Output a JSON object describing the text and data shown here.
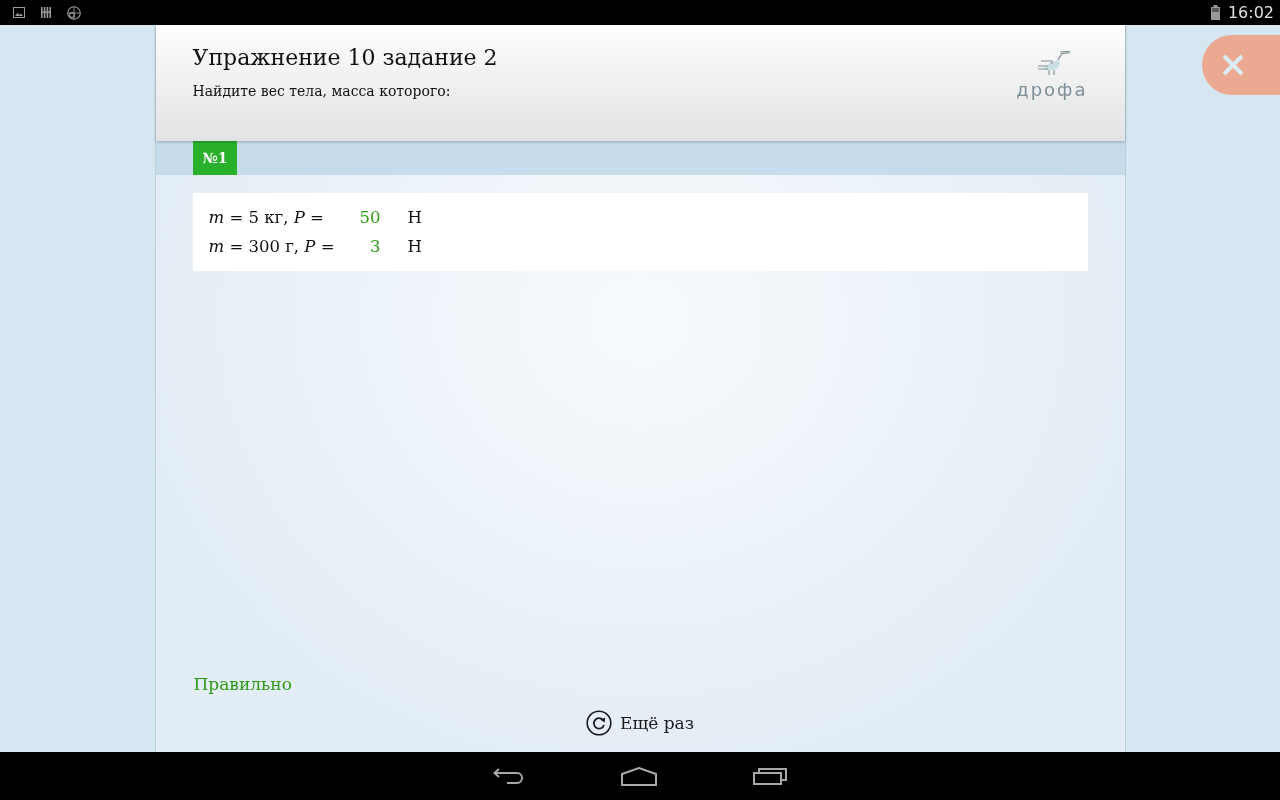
{
  "status_bar": {
    "time": "16:02"
  },
  "header": {
    "title": "Упражнение 10 задание 2",
    "subtitle": "Найдите вес тела, масса которого:",
    "logo": "дрофа"
  },
  "tabs": [
    {
      "label": "№1",
      "selected": true
    }
  ],
  "task": {
    "rows": [
      {
        "question": "*m* = 5 кг, *P* =",
        "answer": "50",
        "unit": "Н",
        "correct": true
      },
      {
        "question": "*m* = 300 г, *P* =",
        "answer": "3",
        "unit": "Н",
        "correct": true
      }
    ]
  },
  "result": {
    "text": "Правильно",
    "correct": true
  },
  "retry_button": {
    "label": "Ещё раз"
  }
}
